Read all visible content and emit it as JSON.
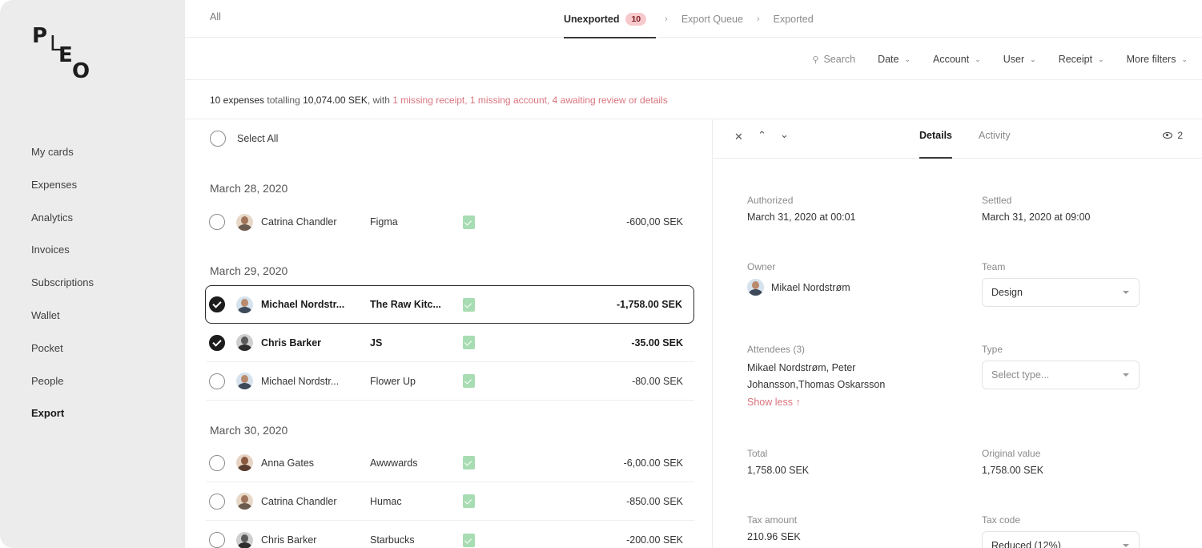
{
  "brand": {
    "logo_letters": [
      "P",
      "L",
      "E",
      "O"
    ]
  },
  "sidebar": {
    "items": [
      {
        "label": "My cards"
      },
      {
        "label": "Expenses"
      },
      {
        "label": "Analytics"
      },
      {
        "label": "Invoices"
      },
      {
        "label": "Subscriptions"
      },
      {
        "label": "Wallet"
      },
      {
        "label": "Pocket"
      },
      {
        "label": "People"
      },
      {
        "label": "Export",
        "active": true
      }
    ]
  },
  "topbar": {
    "all_label": "All",
    "steps": [
      {
        "label": "Unexported",
        "count": "10",
        "active": true
      },
      {
        "label": "Export Queue"
      },
      {
        "label": "Exported"
      }
    ],
    "separator": "›"
  },
  "filters": {
    "search_label": "Search",
    "items": [
      "Date",
      "Account",
      "User",
      "Receipt",
      "More filters"
    ]
  },
  "summary": {
    "count_text": "10 expenses",
    "totalling_text": "totalling",
    "total": "10,074.00 SEK",
    "with_text": ", with",
    "warnings": "1 missing receipt, 1 missing account, 4 awaiting review or details"
  },
  "list": {
    "select_all_label": "Select All",
    "groups": [
      {
        "date": "March 28, 2020",
        "rows": [
          {
            "name": "Catrina Chandler",
            "merchant": "Figma",
            "amount": "-600,00 SEK",
            "checked": false
          }
        ]
      },
      {
        "date": "March 29, 2020",
        "rows": [
          {
            "name": "Michael Nordstr...",
            "merchant": "The Raw Kitc...",
            "amount": "-1,758.00 SEK",
            "checked": true,
            "selected": true
          },
          {
            "name": "Chris Barker",
            "merchant": "JS",
            "amount": "-35.00 SEK",
            "checked": true
          },
          {
            "name": "Michael Nordstr...",
            "merchant": "Flower Up",
            "amount": "-80.00 SEK",
            "checked": false
          }
        ]
      },
      {
        "date": "March 30, 2020",
        "rows": [
          {
            "name": "Anna Gates",
            "merchant": "Awwwards",
            "amount": "-6,00.00 SEK",
            "checked": false
          },
          {
            "name": "Catrina Chandler",
            "merchant": "Humac",
            "amount": "-850.00 SEK",
            "checked": false
          },
          {
            "name": "Chris Barker",
            "merchant": "Starbucks",
            "amount": "-200.00 SEK",
            "checked": false
          }
        ]
      }
    ]
  },
  "detail": {
    "tabs": [
      "Details",
      "Activity"
    ],
    "viewers_count": "2",
    "authorized_label": "Authorized",
    "authorized_value": "March 31, 2020 at 00:01",
    "settled_label": "Settled",
    "settled_value": "March 31, 2020 at 09:00",
    "owner_label": "Owner",
    "owner_value": "Mikael Nordstrøm",
    "team_label": "Team",
    "team_value": "Design",
    "attendees_label": "Attendees (3)",
    "attendees_line1": "Mikael Nordstrøm, Peter",
    "attendees_line2": "Johansson,Thomas Oskarsson",
    "show_less": "Show less ↑",
    "type_label": "Type",
    "type_placeholder": "Select type...",
    "total_label": "Total",
    "total_value": "1,758.00 SEK",
    "original_label": "Original value",
    "original_value": "1,758.00 SEK",
    "tax_amount_label": "Tax amount",
    "tax_amount_value": "210.96 SEK",
    "tax_code_label": "Tax code",
    "tax_code_value": "Reduced (12%)"
  },
  "colors": {
    "sidebar_bg": "#ececec",
    "warning_text": "#d8747e",
    "count_pill_bg": "#f7c9cc",
    "receipt_green": "#a8dcb3"
  }
}
